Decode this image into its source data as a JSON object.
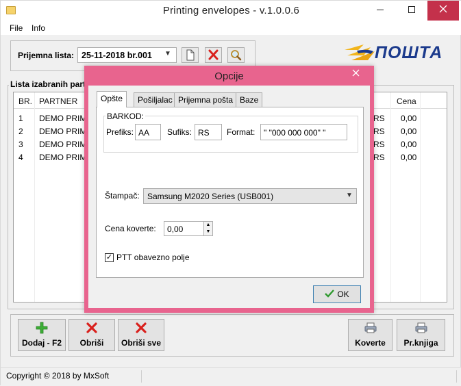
{
  "window": {
    "title": "Printing envelopes - v.1.0.0.6",
    "minimize_icon": "minimize-icon",
    "maximize_icon": "maximize-icon",
    "close_icon": "close-icon"
  },
  "menu": [
    "File",
    "Info"
  ],
  "prijemna": {
    "label": "Prijemna lista:",
    "selected": "25-11-2018  br.001"
  },
  "logo": {
    "text": "ПОШТА",
    "colors": {
      "wings": "#f2b51c",
      "text": "#1b3a8c"
    }
  },
  "table": {
    "group_title": "Lista izabranih partnera",
    "columns": {
      "br": "BR.",
      "partner": "PARTNER",
      "cena": "Cena"
    },
    "rows": [
      {
        "br": "1",
        "partner": "DEMO PRIMA",
        "tail": "RS",
        "cena": "0,00"
      },
      {
        "br": "2",
        "partner": "DEMO PRIMA",
        "tail": "RS",
        "cena": "0,00"
      },
      {
        "br": "3",
        "partner": "DEMO PRIMA",
        "tail": "RS",
        "cena": "0,00"
      },
      {
        "br": "4",
        "partner": "DEMO PRIMA",
        "tail": "RS",
        "cena": "0,00"
      }
    ]
  },
  "buttons": {
    "add": "Dodaj - F2",
    "delete": "Obriši",
    "delete_all": "Obriši sve",
    "envelopes": "Koverte",
    "book": "Pr.knjiga"
  },
  "status": {
    "copyright": "Copyright © 2018 by MxSoft"
  },
  "dialog": {
    "title": "Opcije",
    "tabs": [
      "Opšte",
      "Pošiljalac",
      "Prijemna pošta",
      "Baze"
    ],
    "active_tab": "Opšte",
    "barkod": {
      "label": "BARKOD:",
      "prefix_label": "Prefiks:",
      "prefix_value": "AA",
      "suffix_label": "Sufiks:",
      "suffix_value": "RS",
      "format_label": "Format:",
      "format_value": "\" \"000 000 000\" \""
    },
    "printer": {
      "label": "Štampač:",
      "value": "Samsung M2020 Series (USB001)"
    },
    "price": {
      "label": "Cena koverte:",
      "value": "0,00"
    },
    "ptt": {
      "label": "PTT obavezno polje",
      "checked": true
    },
    "ok": "OK",
    "accent_color": "#e8648e"
  }
}
